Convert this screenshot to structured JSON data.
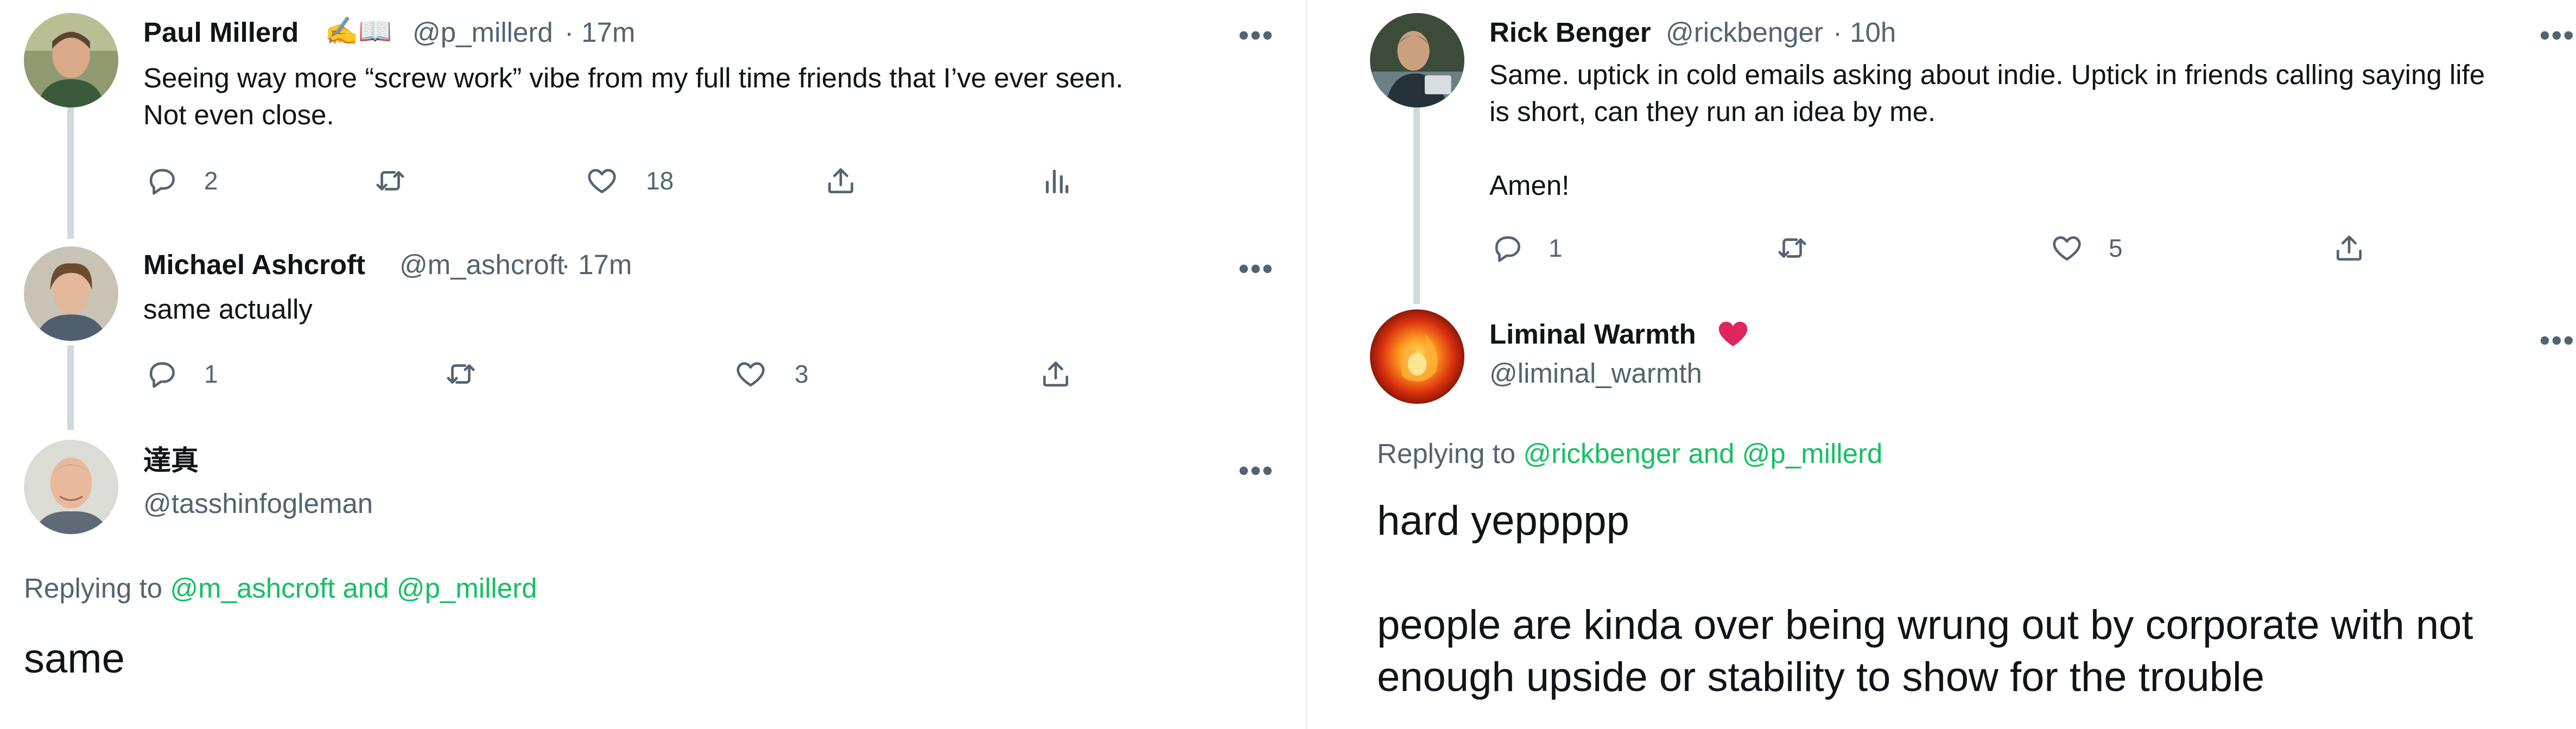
{
  "colors": {
    "text": "#0f1419",
    "muted": "#536471",
    "thread_line": "#cfd9de",
    "mention": "#17bf63",
    "heart_badge": "#e0245e"
  },
  "left_thread": {
    "tweets": [
      {
        "name": "Paul Millerd",
        "badges": "✍️📖",
        "handle": "@p_millerd",
        "time": "· 17m",
        "text": "Seeing way more “screw work” vibe from my full time friends that I’ve ever seen.\nNot even close.",
        "replies": "2",
        "retweets": "",
        "likes": "18",
        "icons": [
          "reply-icon",
          "retweet-icon",
          "like-icon",
          "share-icon",
          "analytics-icon"
        ]
      },
      {
        "name": "Michael Ashcroft",
        "handle": "@m_ashcroft",
        "time": "· 17m",
        "text": "same actually",
        "replies": "1",
        "retweets": "",
        "likes": "3",
        "icons": [
          "reply-icon",
          "retweet-icon",
          "like-icon",
          "share-icon"
        ]
      }
    ],
    "focused": {
      "name": "達真",
      "handle": "@tasshinfogleman",
      "replying_prefix": "Replying to ",
      "replying_mentions": "@m_ashcroft and @p_millerd",
      "text": "same"
    }
  },
  "right_thread": {
    "tweets": [
      {
        "name": "Rick Benger",
        "handle": "@rickbenger",
        "time": "· 10h",
        "text": "Same. uptick in cold emails asking about indie. Uptick in friends calling saying life\nis short, can they run an idea by me.\n\nAmen!",
        "replies": "1",
        "retweets": "",
        "likes": "5",
        "icons": [
          "reply-icon",
          "retweet-icon",
          "like-icon",
          "share-icon"
        ]
      }
    ],
    "focused": {
      "name": "Liminal Warmth",
      "name_badge": "heart-icon",
      "handle": "@liminal_warmth",
      "replying_prefix": "Replying to ",
      "replying_mentions": "@rickbenger and @p_millerd",
      "text": "hard yeppppp\n\npeople are kinda over being wrung out by corporate with not\nenough upside or stability to show for the trouble"
    }
  },
  "more_label": "•••"
}
